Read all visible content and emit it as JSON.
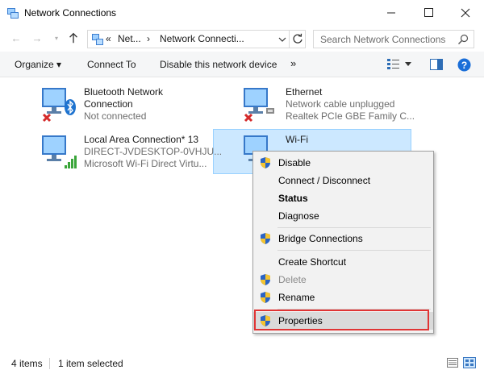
{
  "window": {
    "title": "Network Connections",
    "icon": "network-connections-icon"
  },
  "address": {
    "overflow_glyph": "«",
    "crumb1": "Net...",
    "crumb2": "Network Connecti...",
    "chevron": "›",
    "search_placeholder": "Search Network Connections"
  },
  "toolbar": {
    "organize": "Organize ▾",
    "connect_to": "Connect To",
    "disable_device": "Disable this network device",
    "more": "»"
  },
  "items": [
    {
      "name": "Bluetooth Network",
      "name2": "Connection",
      "status": "Not connected",
      "device": ""
    },
    {
      "name": "Ethernet",
      "status": "Network cable unplugged",
      "device": "Realtek PCIe GBE Family C..."
    },
    {
      "name": "Local Area Connection* 13",
      "status": "DIRECT-JVDESKTOP-0VHJU...",
      "device": "Microsoft Wi-Fi Direct Virtu..."
    },
    {
      "name": "Wi-Fi",
      "status": "",
      "device": ""
    }
  ],
  "context_menu": {
    "disable": "Disable",
    "connect_disconnect": "Connect / Disconnect",
    "status": "Status",
    "diagnose": "Diagnose",
    "bridge": "Bridge Connections",
    "create_shortcut": "Create Shortcut",
    "delete": "Delete",
    "rename": "Rename",
    "properties": "Properties"
  },
  "statusbar": {
    "item_count": "4 items",
    "selected": "1 item selected"
  },
  "colors": {
    "selection": "#cce8ff",
    "highlight_border": "#e03434",
    "help_blue": "#1a6ed8"
  }
}
